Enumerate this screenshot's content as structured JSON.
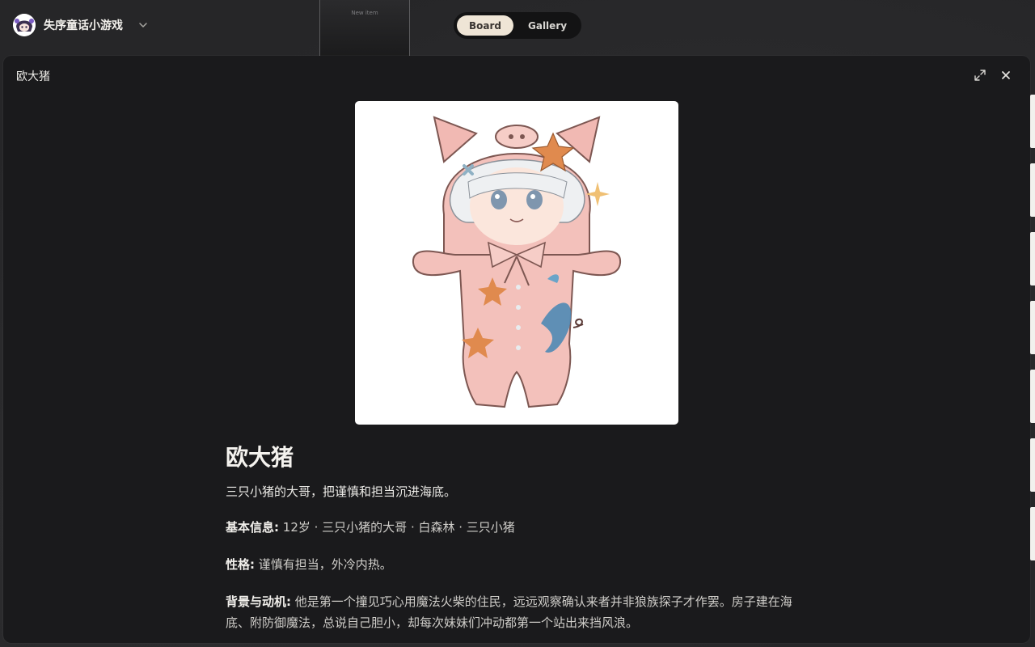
{
  "app": {
    "title": "失序童话小游戏"
  },
  "board": {
    "new_item_label": "New item"
  },
  "view_toggle": {
    "options": [
      "Board",
      "Gallery"
    ],
    "selected": "Board"
  },
  "modal": {
    "title": "欧大猪",
    "character": {
      "name": "欧大猪",
      "tagline": "三只小猪的大哥，把谨慎和担当沉进海底。",
      "fields": [
        {
          "label": "基本信息:",
          "value": "12岁 · 三只小猪的大哥 · 白森林 · 三只小猪"
        },
        {
          "label": "性格:",
          "value": "谨慎有担当，外冷内热。"
        },
        {
          "label": "背景与动机:",
          "value": "他是第一个撞见巧心用魔法火柴的住民，远远观察确认来者并非狼族探子才作罢。房子建在海底、附防御魔法，总说自己胆小，却每次妹妹们冲动都第一个站出来挡风浪。"
        }
      ]
    }
  },
  "colors": {
    "modal_bg": "#1a1a1c",
    "toggle_active": "#efe5d6",
    "portrait_bg": "#ffffff"
  }
}
